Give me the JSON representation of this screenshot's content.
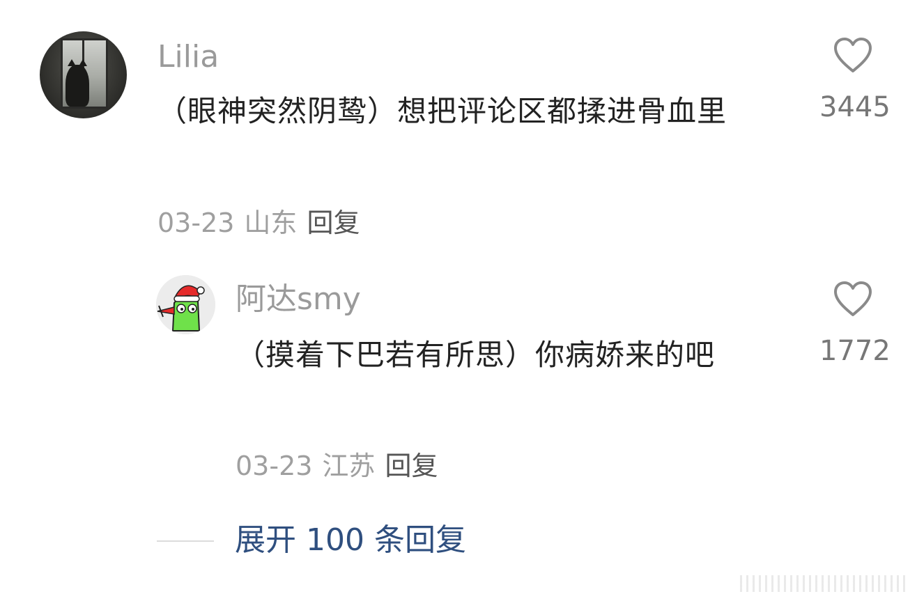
{
  "comment": {
    "username": "Lilia",
    "text": "（眼神突然阴鸷）想把评论区都揉进骨血里",
    "date": "03-23",
    "location": "山东",
    "reply_label": "回复",
    "like_count": "3445",
    "avatar_icon": "cat-at-window-avatar",
    "like_icon": "heart-outline-icon"
  },
  "reply": {
    "username": "阿达smy",
    "text": "（摸着下巴若有所思）你病娇来的吧",
    "date": "03-23",
    "location": "江苏",
    "reply_label": "回复",
    "like_count": "1772",
    "avatar_icon": "frog-santa-hat-avatar",
    "like_icon": "heart-outline-icon"
  },
  "expand": {
    "label": "展开 100 条回复"
  },
  "colors": {
    "link": "#2f4f7f",
    "muted": "#9a9a9a",
    "text": "#222222"
  }
}
